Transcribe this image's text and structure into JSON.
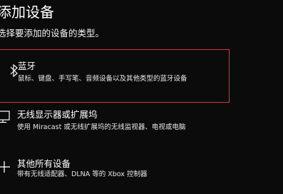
{
  "dialog": {
    "title": "添加设备",
    "subtitle": "选择要添加的设备的类型。"
  },
  "options": [
    {
      "icon": "bluetooth-icon",
      "title": "蓝牙",
      "description": "鼠标、键盘、手写笔、音频设备以及其他类型的蓝牙设备",
      "selected": true
    },
    {
      "icon": "monitor-icon",
      "title": "无线显示器或扩展坞",
      "description": "使用 Miracast 或无线扩展坞的无线监视器、电视或电脑",
      "selected": false
    },
    {
      "icon": "plus-icon",
      "title": "其他所有设备",
      "description": "带有无线适配器、DLNA 等的 Xbox 控制器",
      "selected": false
    }
  ],
  "colors": {
    "background": "#0b0b0b",
    "selection_border": "#e0343a",
    "text": "#ffffff"
  }
}
